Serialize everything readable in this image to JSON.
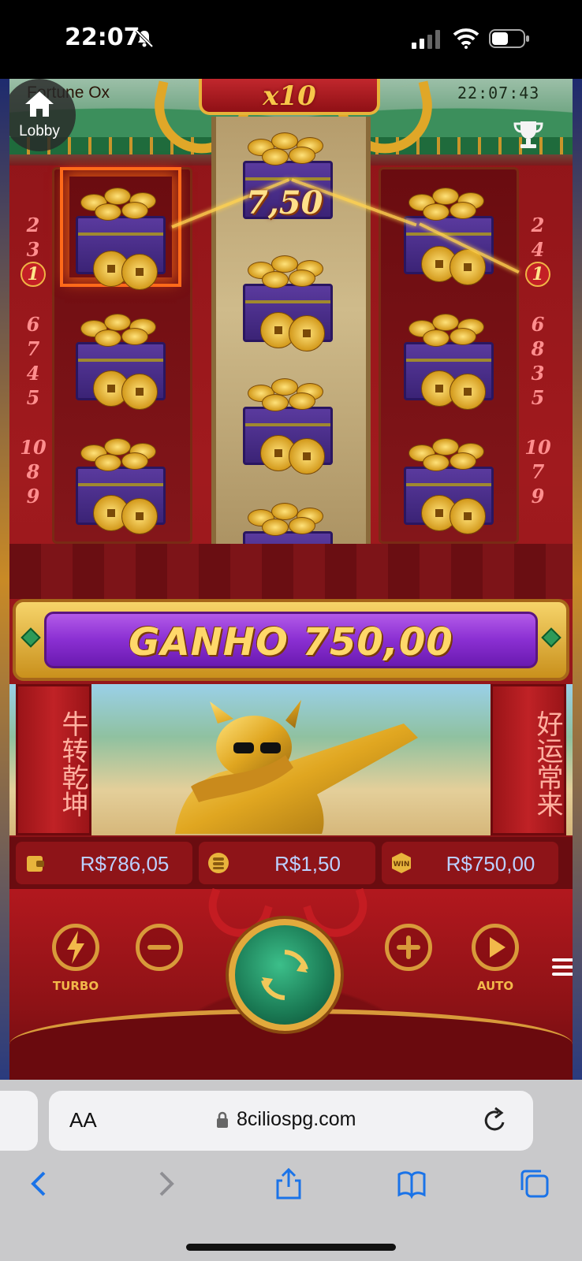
{
  "status_bar": {
    "time": "22:07"
  },
  "game": {
    "title": "Fortune Ox",
    "lobby_label": "Lobby",
    "clock": "22:07:43",
    "multiplier": "x10",
    "win_line_amount": "7,50",
    "paylines_left": [
      "2",
      "3",
      "1",
      "6",
      "7",
      "4",
      "5",
      "10",
      "8",
      "9"
    ],
    "paylines_right": [
      "2",
      "4",
      "1",
      "6",
      "8",
      "3",
      "5",
      "10",
      "7",
      "9"
    ],
    "active_payline": "1",
    "ganho_text": "GANHO 750,00",
    "pillar_left_text": "牛转乾坤",
    "pillar_right_text": "好运常来"
  },
  "info": {
    "balance": "R$786,05",
    "bet": "R$1,50",
    "win": "R$750,00"
  },
  "controls": {
    "turbo_label": "TURBO",
    "auto_label": "AUTO"
  },
  "browser": {
    "aa_label": "AA",
    "url": "8ciliospg.com"
  },
  "colors": {
    "accent_gold": "#e2aa3c",
    "purple_banner": "#8a2fd2",
    "spin_green": "#1a7a54"
  }
}
